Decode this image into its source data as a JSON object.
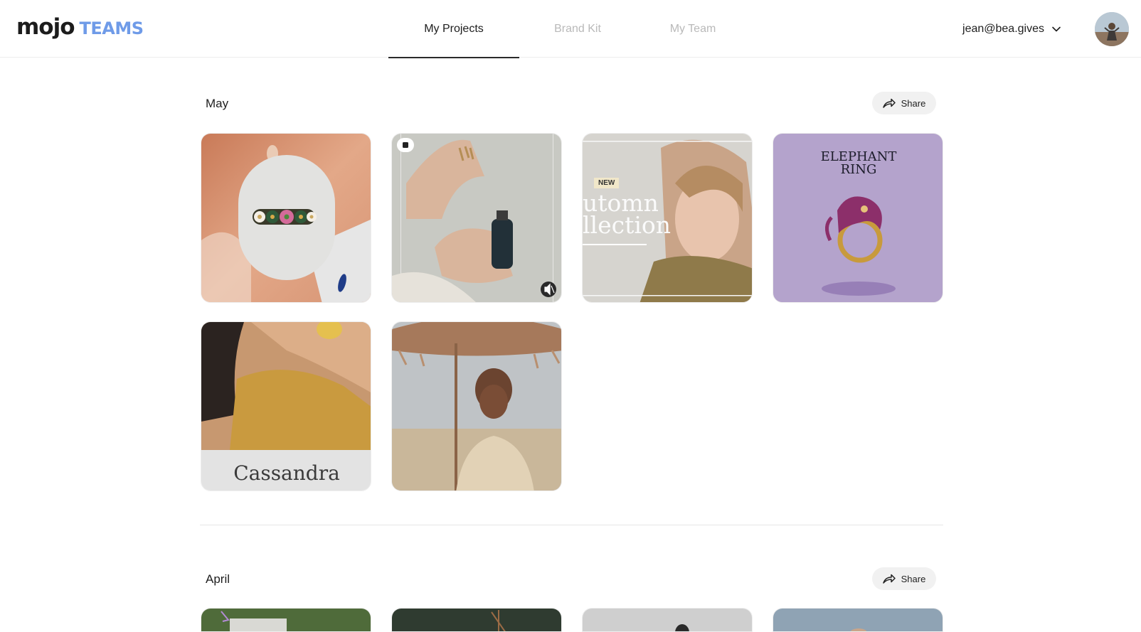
{
  "app": {
    "logo_main": "mojo",
    "logo_sub": "TEAMS",
    "accent_color": "#6f9be8"
  },
  "nav": {
    "tabs": [
      {
        "label": "My Projects",
        "active": true
      },
      {
        "label": "Brand Kit",
        "active": false
      },
      {
        "label": "My Team",
        "active": false
      }
    ]
  },
  "user": {
    "email": "jean@bea.gives",
    "dropdown_icon": "chevron-down-icon",
    "avatar_icon": "user-avatar"
  },
  "sections": [
    {
      "title": "May",
      "share_label": "Share",
      "share_icon": "share-arrow-icon",
      "projects": [
        {
          "name": "earring-flower-ring",
          "overlay_text": ""
        },
        {
          "name": "serum-bottle-hands",
          "badge_icons": [
            "copy-icon",
            "mute-icon"
          ]
        },
        {
          "name": "autumn-collection",
          "badge": "NEW",
          "line1": "utomn",
          "line2": "llection"
        },
        {
          "name": "elephant-ring",
          "title_line1": "ELEPHANT",
          "title_line2": "RING"
        },
        {
          "name": "cassandra",
          "caption": "Cassandra"
        },
        {
          "name": "umbrella-portrait"
        }
      ]
    },
    {
      "title": "April",
      "share_label": "Share",
      "share_icon": "share-arrow-icon",
      "projects": [
        {
          "name": "april-1"
        },
        {
          "name": "april-2"
        },
        {
          "name": "april-3"
        },
        {
          "name": "april-4"
        }
      ]
    }
  ]
}
